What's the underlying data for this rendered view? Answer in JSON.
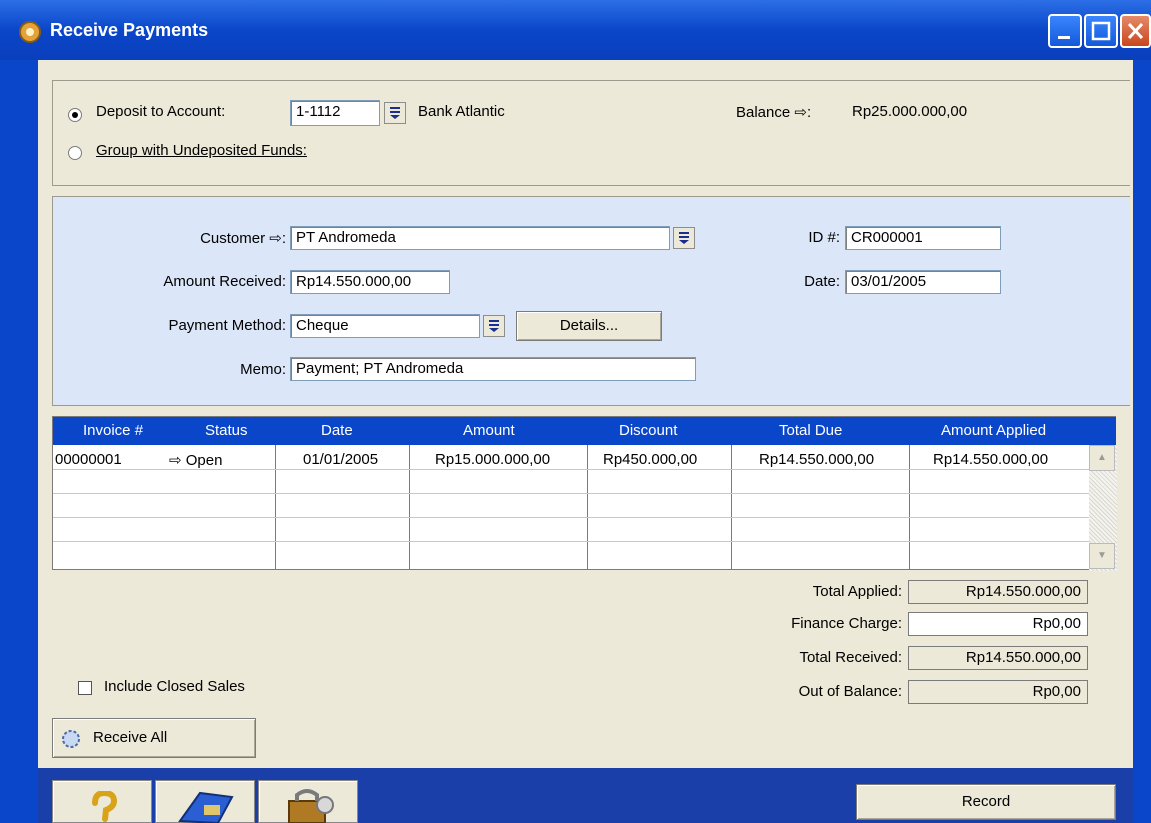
{
  "window": {
    "title": "Receive Payments"
  },
  "deposit": {
    "deposit_label": "Deposit to Account:",
    "group_label": "Group with Undeposited Funds:",
    "account_number": "1-1112",
    "account_name": "Bank Atlantic",
    "balance_label": "Balance ⇨:",
    "balance_value": "Rp25.000.000,00"
  },
  "customer": {
    "customer_label": "Customer ⇨:",
    "customer_value": "PT Andromeda",
    "amount_label": "Amount Received:",
    "amount_value": "Rp14.550.000,00",
    "method_label": "Payment Method:",
    "method_value": "Cheque",
    "details_label": "Details...",
    "memo_label": "Memo:",
    "memo_value": "Payment; PT Andromeda",
    "id_label": "ID #:",
    "id_value": "CR000001",
    "date_label": "Date:",
    "date_value": "03/01/2005"
  },
  "table": {
    "columns": [
      "Invoice #",
      "Status",
      "Date",
      "Amount",
      "Discount",
      "Total Due",
      "Amount Applied"
    ],
    "rows": [
      [
        "00000001",
        "⇨ Open",
        "01/01/2005",
        "Rp15.000.000,00",
        "Rp450.000,00",
        "Rp14.550.000,00",
        "Rp14.550.000,00"
      ]
    ]
  },
  "totals": {
    "applied_label": "Total Applied:",
    "applied_value": "Rp14.550.000,00",
    "finance_label": "Finance Charge:",
    "finance_value": "Rp0,00",
    "received_label": "Total Received:",
    "received_value": "Rp14.550.000,00",
    "balance_label": "Out of Balance:",
    "balance_value": "Rp0,00"
  },
  "include_closed_label": "Include Closed Sales",
  "receive_all_label": "Receive All",
  "record_label": "Record",
  "icons": {
    "help": "help-icon",
    "journal": "journal-icon",
    "lock": "lock-icon"
  },
  "colors": {
    "titlebar": "#0a46c9",
    "customer_panel": "#dbe7f8",
    "window_bg": "#ece9d8"
  }
}
